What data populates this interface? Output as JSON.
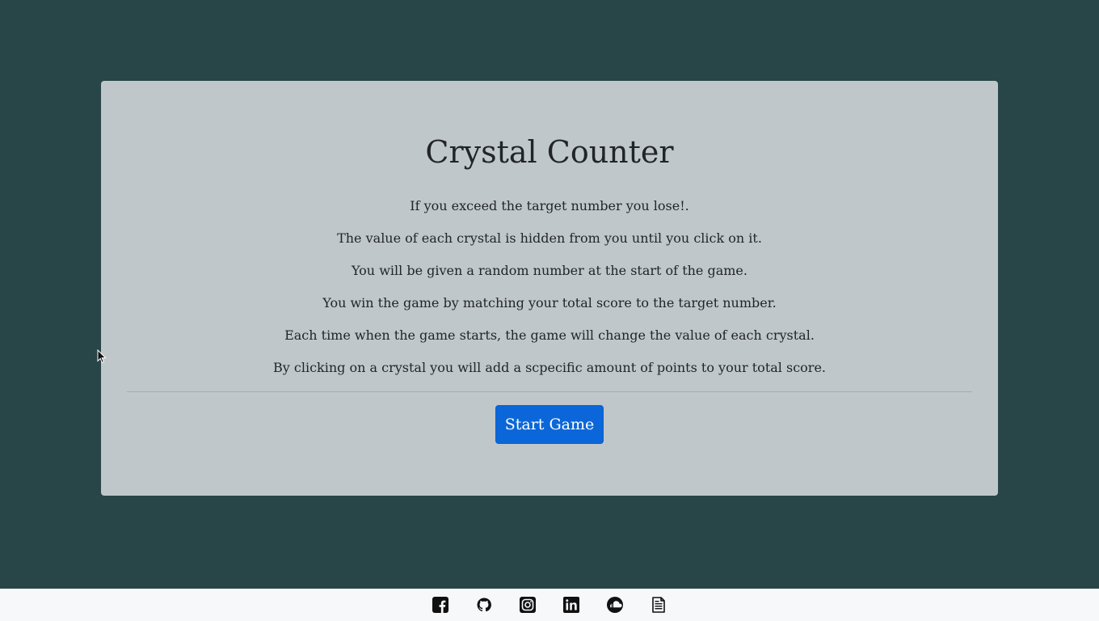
{
  "app": {
    "title": "Crystal Counter"
  },
  "rules": [
    "If you exceed the target number you lose!.",
    "The value of each crystal is hidden from you until you click on it.",
    "You will be given a random number at the start of the game.",
    "You win the game by matching your total score to the target number.",
    "Each time when the game starts, the game will change the value of each crystal.",
    "By clicking on a crystal you will add a scpecific amount of points to your total score."
  ],
  "actions": {
    "start_label": "Start Game"
  },
  "footer": {
    "icons": [
      "facebook-icon",
      "github-icon",
      "instagram-icon",
      "linkedin-icon",
      "soundcloud-icon",
      "resume-document-icon"
    ]
  },
  "colors": {
    "background": "#284547",
    "card": "#c0c7ca",
    "primary_button": "#0b67d9",
    "footer": "#f7f8fa",
    "text": "#212529"
  }
}
